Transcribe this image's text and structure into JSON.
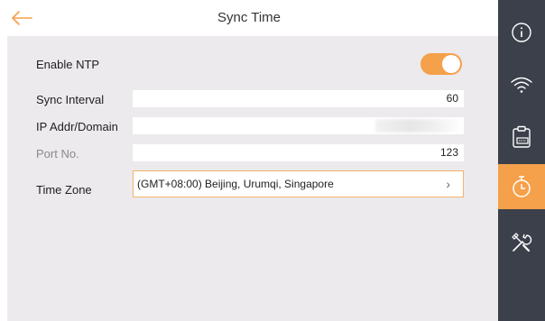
{
  "header": {
    "title": "Sync Time"
  },
  "settings": {
    "enable_ntp": {
      "label": "Enable NTP",
      "enabled": true
    },
    "sync_interval": {
      "label": "Sync Interval",
      "value": "60"
    },
    "ip_addr": {
      "label": "IP Addr/Domain",
      "value": ""
    },
    "port": {
      "label": "Port No.",
      "value": "123"
    },
    "time_zone": {
      "label": "Time Zone",
      "value": "(GMT+08:00) Beijing, Urumqi, Singapore"
    }
  },
  "sidebar": {
    "items": [
      {
        "icon": "info-icon",
        "active": false
      },
      {
        "icon": "wifi-icon",
        "active": false
      },
      {
        "icon": "clipboard-icon",
        "active": false
      },
      {
        "icon": "timer-icon",
        "active": true
      },
      {
        "icon": "tools-icon",
        "active": false
      }
    ]
  },
  "colors": {
    "accent": "#f5a04a",
    "sidebar_bg": "#3b404b",
    "content_bg": "#eceaec"
  }
}
